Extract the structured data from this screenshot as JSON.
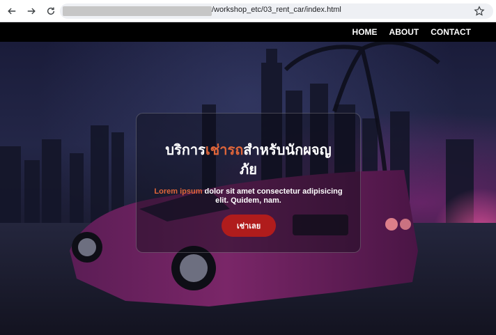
{
  "browser": {
    "url": "/workshop_etc/03_rent_car/index.html",
    "icons": [
      "back-arrow-icon",
      "forward-arrow-icon",
      "reload-icon",
      "star-icon"
    ]
  },
  "nav": {
    "items": [
      "HOME",
      "ABOUT",
      "CONTACT"
    ]
  },
  "hero": {
    "title_part1": "บริการ",
    "title_accent": "เช่ารถ",
    "title_part2": "สำหรับนักผจญภัย",
    "tagline_accent": "Lorem ipsum",
    "tagline_rest": " dolor sit amet consectetur adipisicing elit. Quidem, nam.",
    "cta_label": "เช่าเลย"
  },
  "colors": {
    "accent": "#e0663a",
    "cta": "#b01c1c",
    "header_bg": "#000000"
  }
}
